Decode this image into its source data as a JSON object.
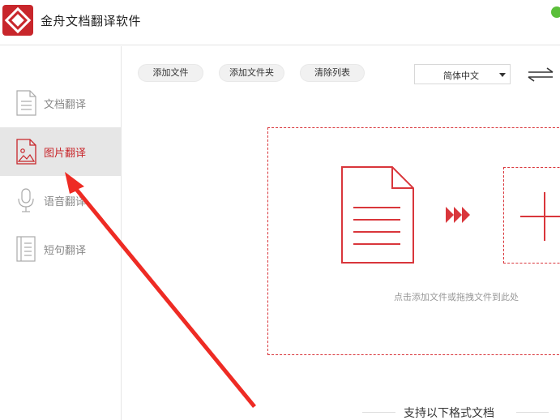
{
  "app": {
    "title": "金舟文档翻译软件",
    "accent_color": "#c8262b"
  },
  "sidebar": {
    "items": [
      {
        "label": "文档翻译",
        "icon": "document-icon",
        "active": false
      },
      {
        "label": "图片翻译",
        "icon": "image-icon",
        "active": true
      },
      {
        "label": "语音翻译",
        "icon": "microphone-icon",
        "active": false
      },
      {
        "label": "短句翻译",
        "icon": "text-lines-icon",
        "active": false
      }
    ]
  },
  "toolbar": {
    "add_file": "添加文件",
    "add_folder": "添加文件夹",
    "clear_list": "清除列表",
    "target_language": "简体中文",
    "swap_icon": "swap-arrows-icon"
  },
  "dropzone": {
    "hint": "点击添加文件或拖拽文件到此处",
    "doc_icon": "document-icon",
    "arrow_icon": "triple-chevron-right-icon",
    "add_icon": "plus-icon"
  },
  "formats": {
    "title": "支持以下格式文档"
  }
}
